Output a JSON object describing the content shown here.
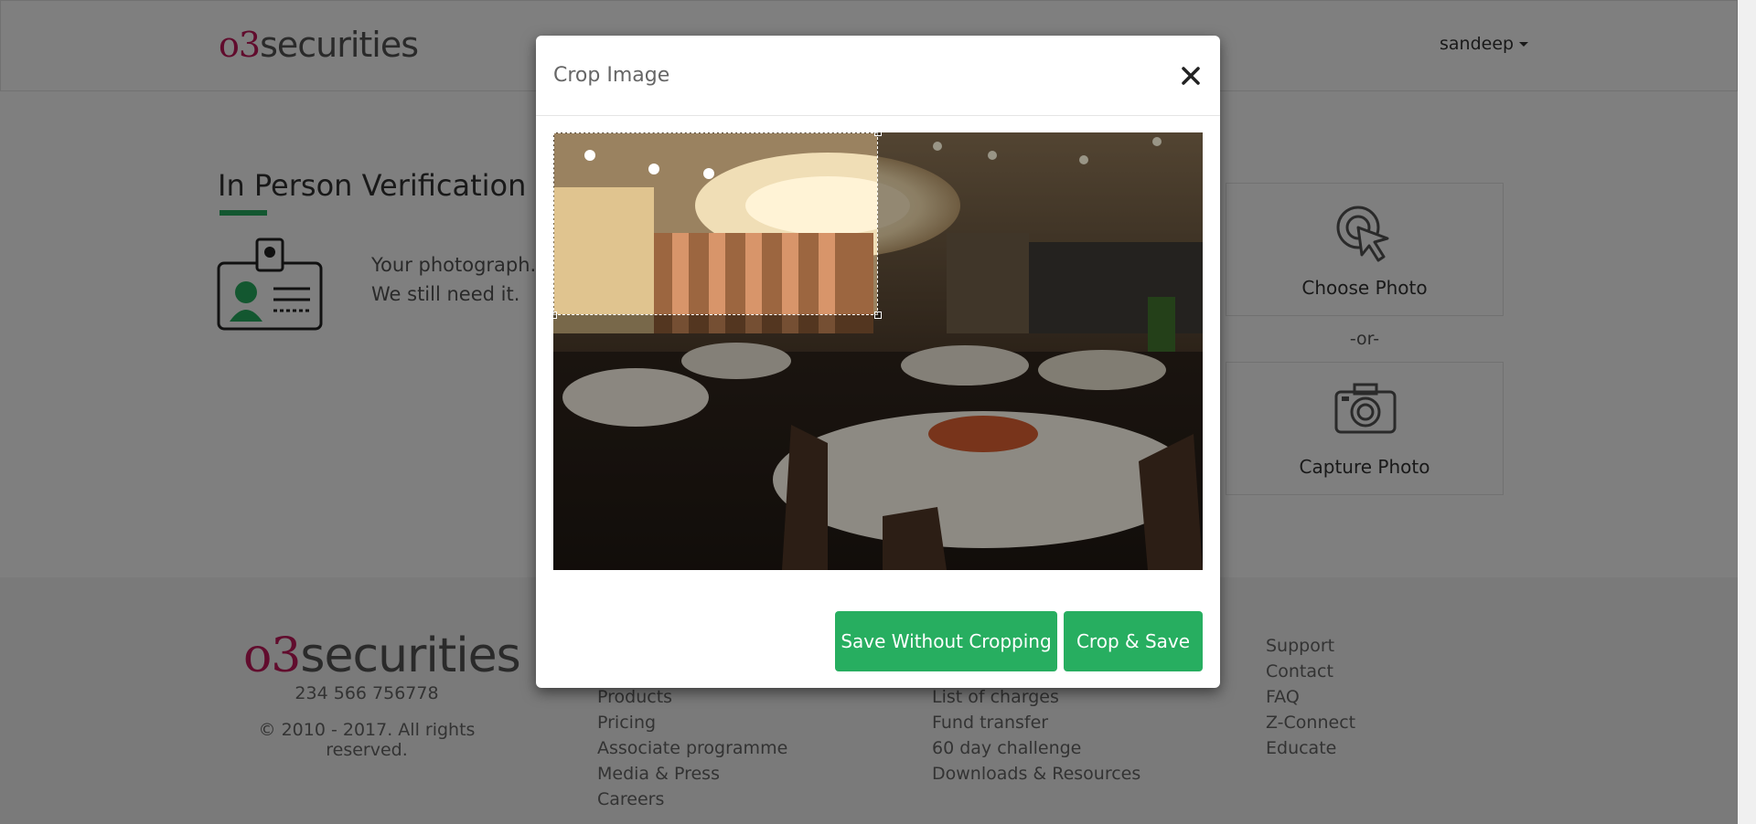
{
  "header": {
    "logo": {
      "mark": "o3",
      "word": "securities"
    },
    "user_name": "sandeep"
  },
  "main": {
    "title": "In Person Verification",
    "description_line1": "Your photograph.",
    "description_line2": "We still need it.",
    "choose_photo_label": "Choose Photo",
    "or_label": "-or-",
    "capture_photo_label": "Capture Photo"
  },
  "footer": {
    "logo": {
      "mark": "o3",
      "word": "securities"
    },
    "phone": "234 566 756778",
    "copyright": "© 2010 - 2017. All rights reserved.",
    "col1": [
      "Products",
      "Pricing",
      "Associate programme",
      "Media & Press",
      "Careers"
    ],
    "col2": [
      "List of charges",
      "Fund transfer",
      "60 day challenge",
      "Downloads & Resources"
    ],
    "col3": [
      "Support",
      "Contact",
      "FAQ",
      "Z-Connect",
      "Educate"
    ]
  },
  "modal": {
    "title": "Crop Image",
    "close_symbol": "✕",
    "save_without_cropping_label": "Save Without Cropping",
    "crop_save_label": "Crop & Save",
    "crop_selection": {
      "width_fraction": 0.5,
      "height_fraction": 0.42
    }
  },
  "colors": {
    "accent_green": "#27ae60",
    "brand_pink": "#c2185b",
    "footer_bg": "#f5f5f5"
  }
}
